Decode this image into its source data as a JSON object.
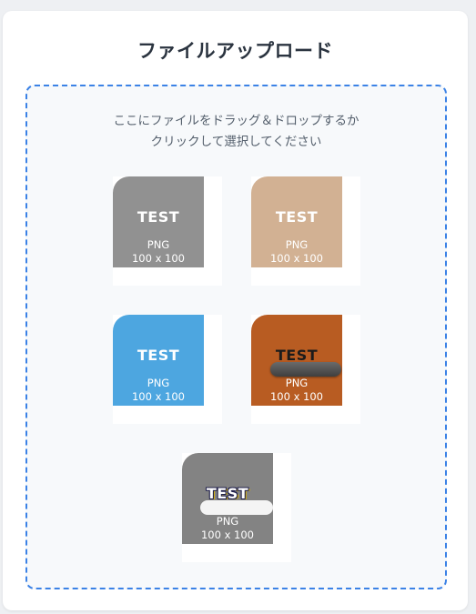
{
  "page": {
    "title": "ファイルアップロード"
  },
  "dropzone": {
    "instruction_line1": "ここにファイルをドラッグ＆ドロップするか",
    "instruction_line2": "クリックして選択してください"
  },
  "thumbnails": [
    {
      "label": "TEST",
      "format": "PNG",
      "size": "100 x 100",
      "color": "#919191"
    },
    {
      "label": "TEST",
      "format": "PNG",
      "size": "100 x 100",
      "color": "#d2b193"
    },
    {
      "label": "TEST",
      "format": "PNG",
      "size": "100 x 100",
      "color": "#4da6e0"
    },
    {
      "label": "TEST",
      "format": "PNG",
      "size": "100 x 100",
      "color": "#b85c22"
    },
    {
      "label": "TEST",
      "format": "PNG",
      "size": "100 x 100",
      "color": "#838383"
    }
  ]
}
